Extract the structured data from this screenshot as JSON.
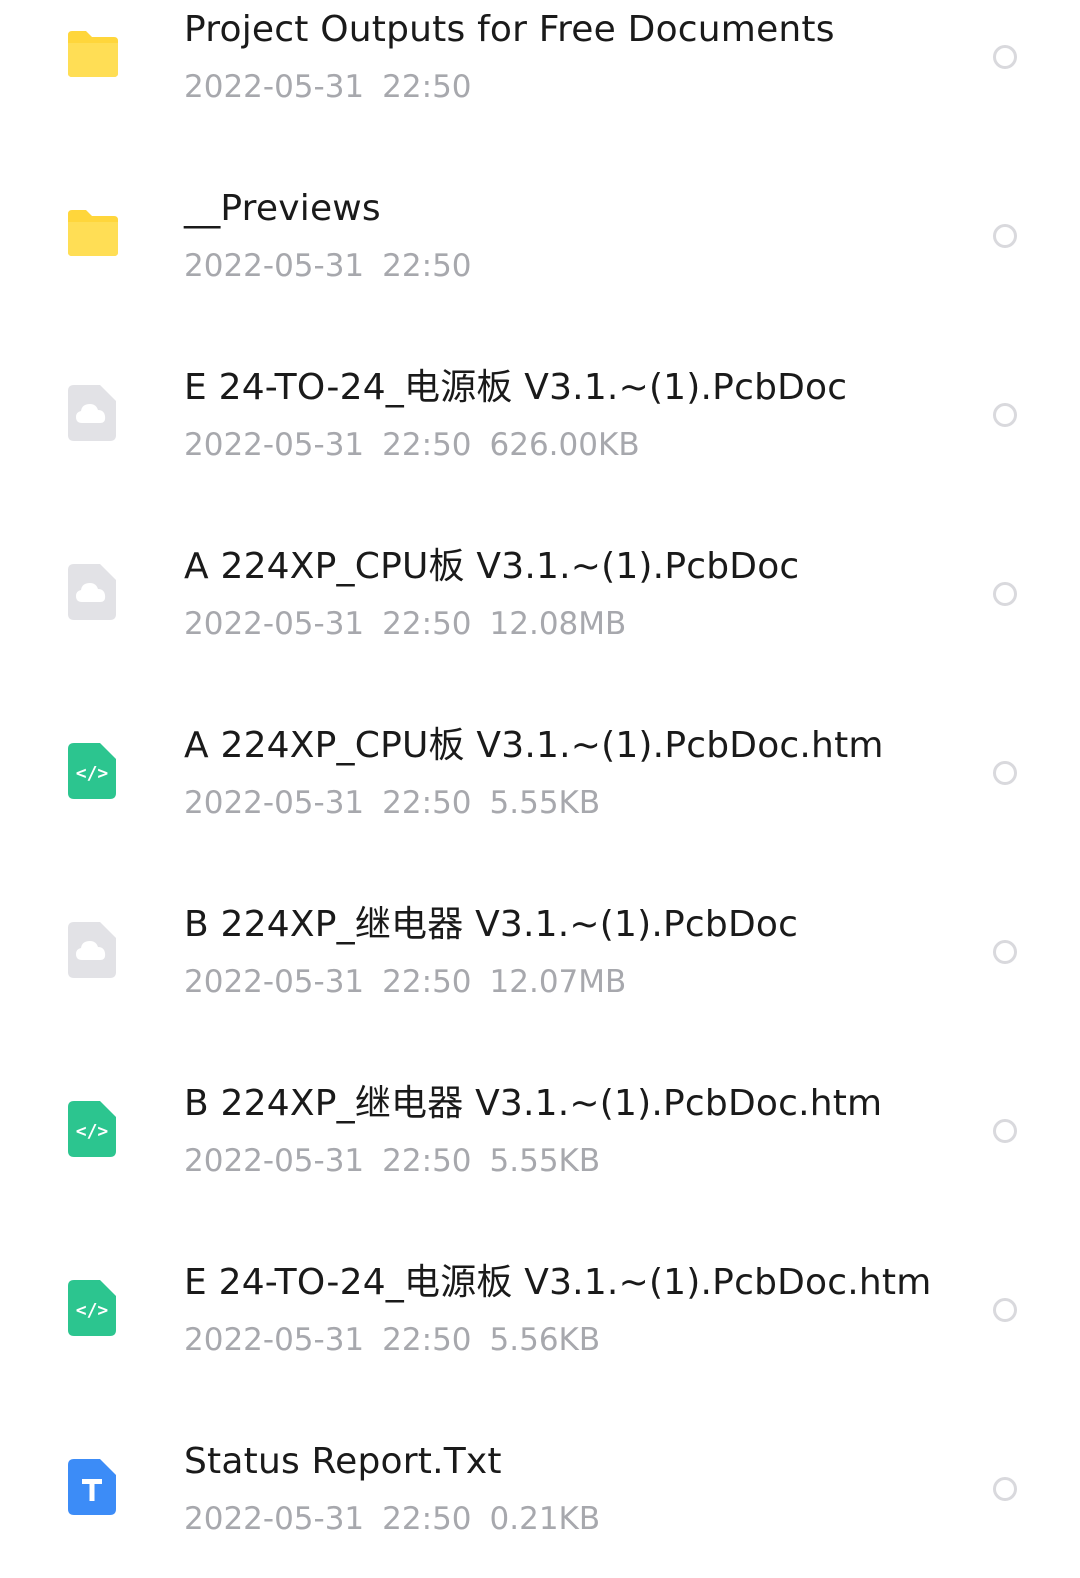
{
  "colors": {
    "folder": "#FFD63B",
    "cloud_file": "#E2E2E6",
    "html_file": "#2CC58F",
    "txt_file": "#3C8CF7",
    "name_text": "#1a1a1a",
    "meta_text": "#a7a8ad",
    "radio_border": "#d9d9dd"
  },
  "files": [
    {
      "name": "Project Outputs for Free Documents",
      "date": "2022-05-31",
      "time": "22:50",
      "size": "",
      "icon": "folder-icon"
    },
    {
      "name": "__Previews",
      "date": "2022-05-31",
      "time": "22:50",
      "size": "",
      "icon": "folder-icon"
    },
    {
      "name": "E 24-TO-24_电源板 V3.1.~(1).PcbDoc",
      "date": "2022-05-31",
      "time": "22:50",
      "size": "626.00KB",
      "icon": "cloud-file-icon"
    },
    {
      "name": "A 224XP_CPU板 V3.1.~(1).PcbDoc",
      "date": "2022-05-31",
      "time": "22:50",
      "size": "12.08MB",
      "icon": "cloud-file-icon"
    },
    {
      "name": "A 224XP_CPU板 V3.1.~(1).PcbDoc.htm",
      "date": "2022-05-31",
      "time": "22:50",
      "size": "5.55KB",
      "icon": "html-file-icon"
    },
    {
      "name": "B 224XP_继电器 V3.1.~(1).PcbDoc",
      "date": "2022-05-31",
      "time": "22:50",
      "size": "12.07MB",
      "icon": "cloud-file-icon"
    },
    {
      "name": "B 224XP_继电器 V3.1.~(1).PcbDoc.htm",
      "date": "2022-05-31",
      "time": "22:50",
      "size": "5.55KB",
      "icon": "html-file-icon"
    },
    {
      "name": "E 24-TO-24_电源板 V3.1.~(1).PcbDoc.htm",
      "date": "2022-05-31",
      "time": "22:50",
      "size": "5.56KB",
      "icon": "html-file-icon"
    },
    {
      "name": "Status Report.Txt",
      "date": "2022-05-31",
      "time": "22:50",
      "size": "0.21KB",
      "icon": "txt-file-icon"
    }
  ]
}
